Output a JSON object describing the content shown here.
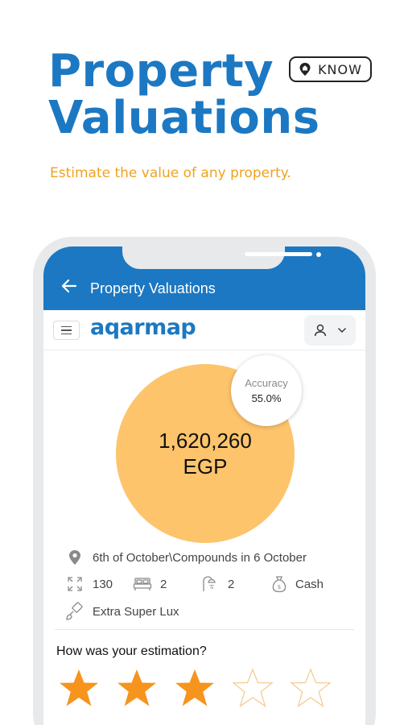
{
  "hero": {
    "title_line1": "Property",
    "title_line2": "Valuations",
    "badge": "KNOW",
    "subtitle": "Estimate the value of any property."
  },
  "appbar": {
    "title": "Property Valuations",
    "back_icon": "arrow-left-icon"
  },
  "site": {
    "logo": "aqarmap"
  },
  "valuation": {
    "amount": "1,620,260",
    "currency": "EGP",
    "accuracy_label": "Accuracy",
    "accuracy_value": "55.0%"
  },
  "details": {
    "location": "6th of October\\Compounds in 6 October",
    "area": "130",
    "bedrooms": "2",
    "bathrooms": "2",
    "payment": "Cash",
    "finishing": "Extra Super Lux"
  },
  "rating": {
    "question": "How was your estimation?",
    "value": 3,
    "max": 5
  },
  "colors": {
    "brand_blue": "#1c78c2",
    "accent_orange": "#f0a21f",
    "circle": "#fdc46c",
    "star": "#f7941d"
  }
}
